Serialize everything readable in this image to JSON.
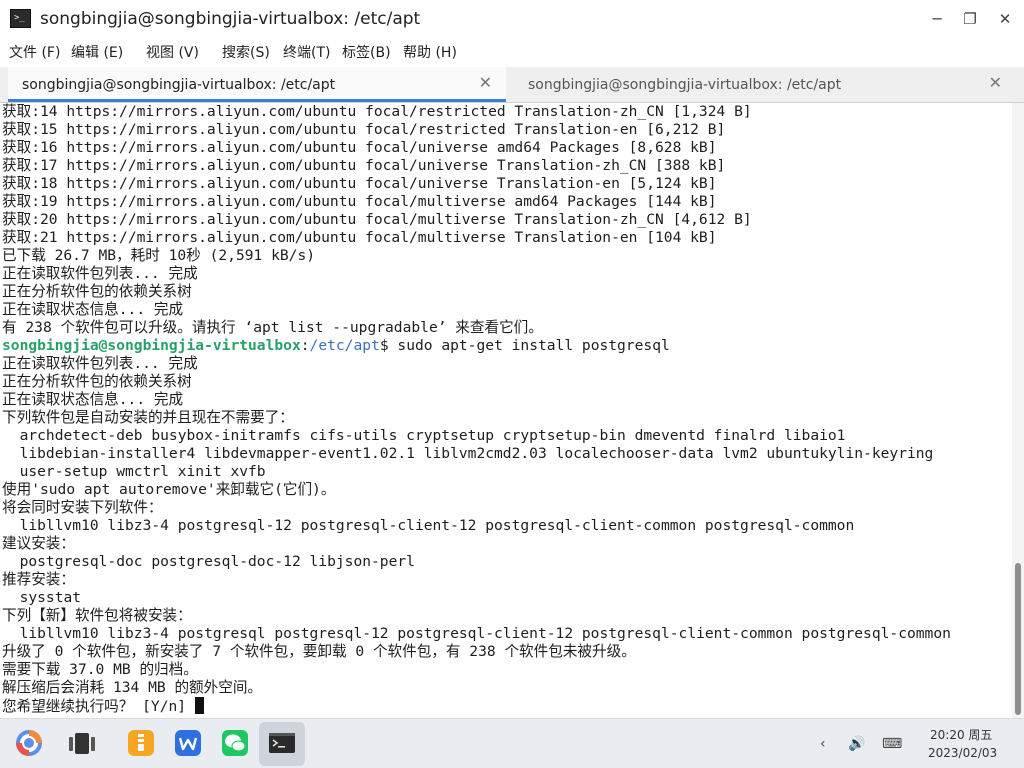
{
  "window": {
    "title": "songbingjia@songbingjia-virtualbox: /etc/apt",
    "minimize": "─",
    "restore": "❐",
    "close": "✕"
  },
  "menu": [
    "文件 (F)",
    "编辑 (E)",
    "视图 (V)",
    "搜索(S)",
    "终端(T)",
    "标签(B)",
    "帮助 (H)"
  ],
  "tabs": [
    {
      "label": "songbingjia@songbingjia-virtualbox: /etc/apt",
      "close": "✕",
      "active": true
    },
    {
      "label": "songbingjia@songbingjia-virtualbox: /etc/apt",
      "close": "✕",
      "active": false
    }
  ],
  "terminal": {
    "lines": [
      "获取:14 https://mirrors.aliyun.com/ubuntu focal/restricted Translation-zh_CN [1,324 B]",
      "获取:15 https://mirrors.aliyun.com/ubuntu focal/restricted Translation-en [6,212 B]",
      "获取:16 https://mirrors.aliyun.com/ubuntu focal/universe amd64 Packages [8,628 kB]",
      "获取:17 https://mirrors.aliyun.com/ubuntu focal/universe Translation-zh_CN [388 kB]",
      "获取:18 https://mirrors.aliyun.com/ubuntu focal/universe Translation-en [5,124 kB]",
      "获取:19 https://mirrors.aliyun.com/ubuntu focal/multiverse amd64 Packages [144 kB]",
      "获取:20 https://mirrors.aliyun.com/ubuntu focal/multiverse Translation-zh_CN [4,612 B]",
      "获取:21 https://mirrors.aliyun.com/ubuntu focal/multiverse Translation-en [104 kB]",
      "已下载 26.7 MB，耗时 10秒 (2,591 kB/s)",
      "正在读取软件包列表... 完成",
      "正在分析软件包的依赖关系树",
      "正在读取状态信息... 完成",
      "有 238 个软件包可以升级。请执行 ‘apt list --upgradable’ 来查看它们。"
    ],
    "prompt": {
      "user": "songbingjia@songbingjia-virtualbox",
      "sep": ":",
      "path": "/etc/apt",
      "symbol": "$ ",
      "command": "sudo apt-get install postgresql"
    },
    "lines_after": [
      "正在读取软件包列表... 完成",
      "正在分析软件包的依赖关系树",
      "正在读取状态信息... 完成",
      "下列软件包是自动安装的并且现在不需要了：",
      "  archdetect-deb busybox-initramfs cifs-utils cryptsetup cryptsetup-bin dmeventd finalrd libaio1",
      "  libdebian-installer4 libdevmapper-event1.02.1 liblvm2cmd2.03 localechooser-data lvm2 ubuntukylin-keyring",
      "  user-setup wmctrl xinit xvfb",
      "使用'sudo apt autoremove'来卸载它(它们)。",
      "将会同时安装下列软件：",
      "  libllvm10 libz3-4 postgresql-12 postgresql-client-12 postgresql-client-common postgresql-common",
      "建议安装：",
      "  postgresql-doc postgresql-doc-12 libjson-perl",
      "推荐安装：",
      "  sysstat",
      "下列【新】软件包将被安装：",
      "  libllvm10 libz3-4 postgresql postgresql-12 postgresql-client-12 postgresql-client-common postgresql-common",
      "升级了 0 个软件包，新安装了 7 个软件包，要卸载 0 个软件包，有 238 个软件包未被升级。",
      "需要下载 37.0 MB 的归档。",
      "解压缩后会消耗 134 MB 的额外空间。"
    ],
    "input_prompt": "您希望继续执行吗？ [Y/n] "
  },
  "taskbar": {
    "icons": [
      "start-menu-icon",
      "multitask-view-icon",
      "file-manager-icon",
      "wps-office-icon",
      "wechat-icon",
      "terminal-icon"
    ],
    "tray": {
      "chevron": "‹",
      "volume": "🔊",
      "keyboard": "⌨"
    },
    "time": "20:20 周五",
    "date": "2023/02/03"
  },
  "colors": {
    "prompt_user": "#26a269",
    "prompt_path": "#3d6fc4",
    "tab_accent": "#3d7fd1"
  }
}
